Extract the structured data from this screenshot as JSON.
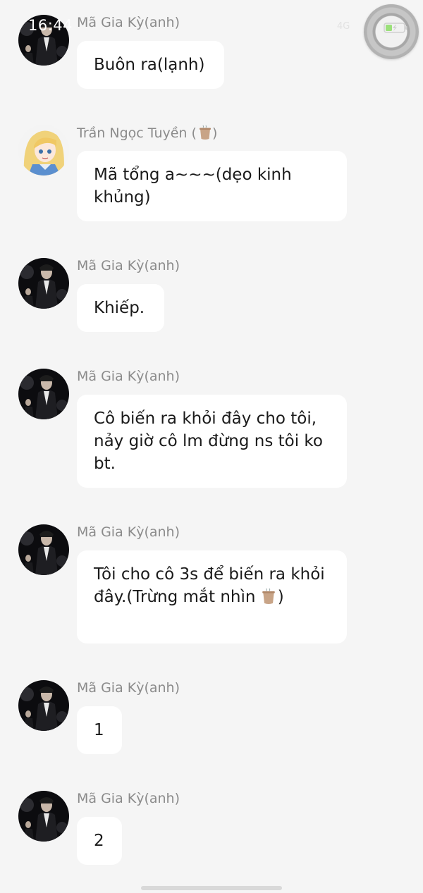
{
  "status_bar": {
    "time": "16:44",
    "signal": "4G",
    "battery_icon": "battery-charging-icon"
  },
  "messages": [
    {
      "sender": "Mã Gia Kỳ(anh)",
      "avatar": "man-dark-suit-avatar",
      "text": "Buôn ra(lạnh)"
    },
    {
      "sender": "Trần Ngọc Tuyền (",
      "sender_suffix": ")",
      "avatar": "anime-girl-avatar",
      "text": "Mã tổng a~~~(dẹo kinh khủng)"
    },
    {
      "sender": "Mã Gia Kỳ(anh)",
      "avatar": "man-dark-suit-avatar",
      "text": "Khiếp."
    },
    {
      "sender": "Mã Gia Kỳ(anh)",
      "avatar": "man-dark-suit-avatar",
      "text": "Cô biến ra khỏi đây cho tôi, nảy giờ cô lm đừng ns tôi ko bt."
    },
    {
      "sender": "Mã Gia Kỳ(anh)",
      "avatar": "man-dark-suit-avatar",
      "text": "Tôi cho cô 3s để biến ra khỏi đây.(Trừng mắt nhìn",
      "text_suffix": ")"
    },
    {
      "sender": "Mã Gia Kỳ(anh)",
      "avatar": "man-dark-suit-avatar",
      "text": "1"
    },
    {
      "sender": "Mã Gia Kỳ(anh)",
      "avatar": "man-dark-suit-avatar",
      "text": "2"
    }
  ]
}
